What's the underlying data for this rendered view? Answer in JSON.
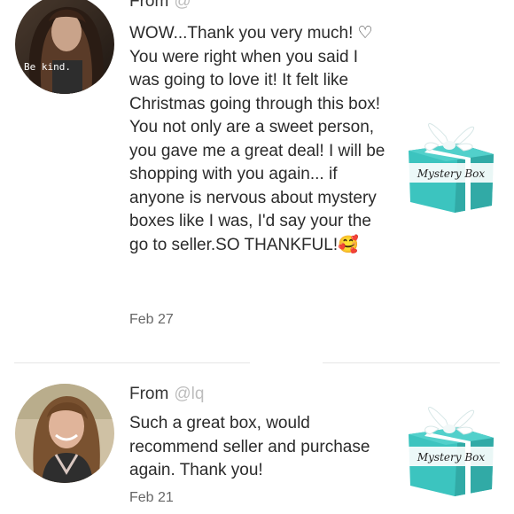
{
  "reviews": [
    {
      "from_label": "From",
      "handle": "@",
      "avatar_caption": "Be kind.",
      "text": "WOW...Thank you very much! ♡ You were right when you said I was going to love it! It felt like Christmas going through this box! You not only are a sweet person, you gave me a great deal! I will be shopping with you again... if anyone is nervous about mystery boxes like I was, I'd say your the go to seller.SO THANKFUL!🥰",
      "date": "Feb 27",
      "product_label": "Mystery Box"
    },
    {
      "from_label": "From",
      "handle": "@lq",
      "text": "Such a great box, would recommend seller and purchase again. Thank you!",
      "date": "Feb 21",
      "product_label": "Mystery Box"
    }
  ],
  "colors": {
    "box_teal": "#39c2bd",
    "ribbon": "#ffffff",
    "date_gray": "#666666"
  }
}
